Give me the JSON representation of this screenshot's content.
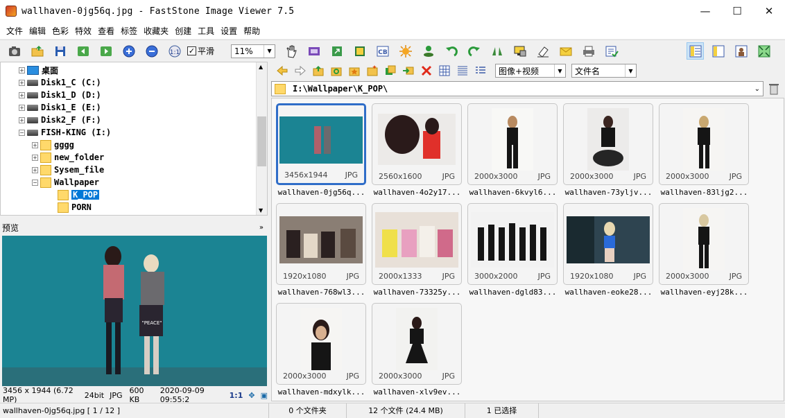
{
  "window": {
    "title": "wallhaven-0jg56q.jpg  -  FastStone Image Viewer 7.5"
  },
  "menu": [
    "文件",
    "编辑",
    "色彩",
    "特效",
    "查看",
    "标签",
    "收藏夹",
    "创建",
    "工具",
    "设置",
    "帮助"
  ],
  "toolbar": {
    "smooth_label": "平滑",
    "smooth_checked": "✓",
    "zoom_value": "11%"
  },
  "tree": {
    "items": [
      {
        "label": "桌面",
        "type": "desktop"
      },
      {
        "label": "Disk1_C (C:)",
        "type": "drive"
      },
      {
        "label": "Disk1_D (D:)",
        "type": "drive"
      },
      {
        "label": "Disk1_E (E:)",
        "type": "drive"
      },
      {
        "label": "Disk2_F (F:)",
        "type": "drive"
      },
      {
        "label": "FISH-KING (I:)",
        "type": "drive"
      },
      {
        "label": "gggg",
        "type": "folder"
      },
      {
        "label": "new_folder",
        "type": "folder"
      },
      {
        "label": "Sysem_file",
        "type": "folder"
      },
      {
        "label": "Wallpaper",
        "type": "folder"
      },
      {
        "label": "K_POP",
        "type": "folder",
        "selected": true
      },
      {
        "label": "PORN",
        "type": "folder"
      }
    ]
  },
  "preview": {
    "header": "预览",
    "info": {
      "dimensions": "3456 x 1944 (6.72 MP)",
      "depth": "24bit",
      "format": "JPG",
      "size": "600 KB",
      "date": "2020-09-09 09:55:2",
      "ratio": "1:1"
    },
    "sign_text": "\"PEACE\""
  },
  "filter": {
    "view_mode": "图像+视频",
    "sort_by": "文件名"
  },
  "path": "I:\\Wallpaper\\K_POP\\",
  "thumbnails": [
    {
      "dims": "3456x1944",
      "ext": "JPG",
      "name": "wallhaven-0jg56q...",
      "selected": true
    },
    {
      "dims": "2560x1600",
      "ext": "JPG",
      "name": "wallhaven-4o2y17..."
    },
    {
      "dims": "2000x3000",
      "ext": "JPG",
      "name": "wallhaven-6kvyl6..."
    },
    {
      "dims": "2000x3000",
      "ext": "JPG",
      "name": "wallhaven-73yljv..."
    },
    {
      "dims": "2000x3000",
      "ext": "JPG",
      "name": "wallhaven-83ljg2..."
    },
    {
      "dims": "1920x1080",
      "ext": "JPG",
      "name": "wallhaven-768wl3..."
    },
    {
      "dims": "2000x1333",
      "ext": "JPG",
      "name": "wallhaven-73325y..."
    },
    {
      "dims": "3000x2000",
      "ext": "JPG",
      "name": "wallhaven-dgld83..."
    },
    {
      "dims": "1920x1080",
      "ext": "JPG",
      "name": "wallhaven-eoke28..."
    },
    {
      "dims": "2000x3000",
      "ext": "JPG",
      "name": "wallhaven-eyj28k..."
    },
    {
      "dims": "2000x3000",
      "ext": "JPG",
      "name": "wallhaven-mdxylk..."
    },
    {
      "dims": "2000x3000",
      "ext": "JPG",
      "name": "wallhaven-xlv9ev..."
    }
  ],
  "status": {
    "file": "wallhaven-0jg56q.jpg [ 1 / 12 ]",
    "folders": "0 个文件夹",
    "files": "12 个文件 (24.4 MB)",
    "selected": "1 已选择"
  },
  "colors": {
    "accent": "#2f6dc8",
    "selection": "#0078d7",
    "preview_bg": "#1a7f90"
  }
}
